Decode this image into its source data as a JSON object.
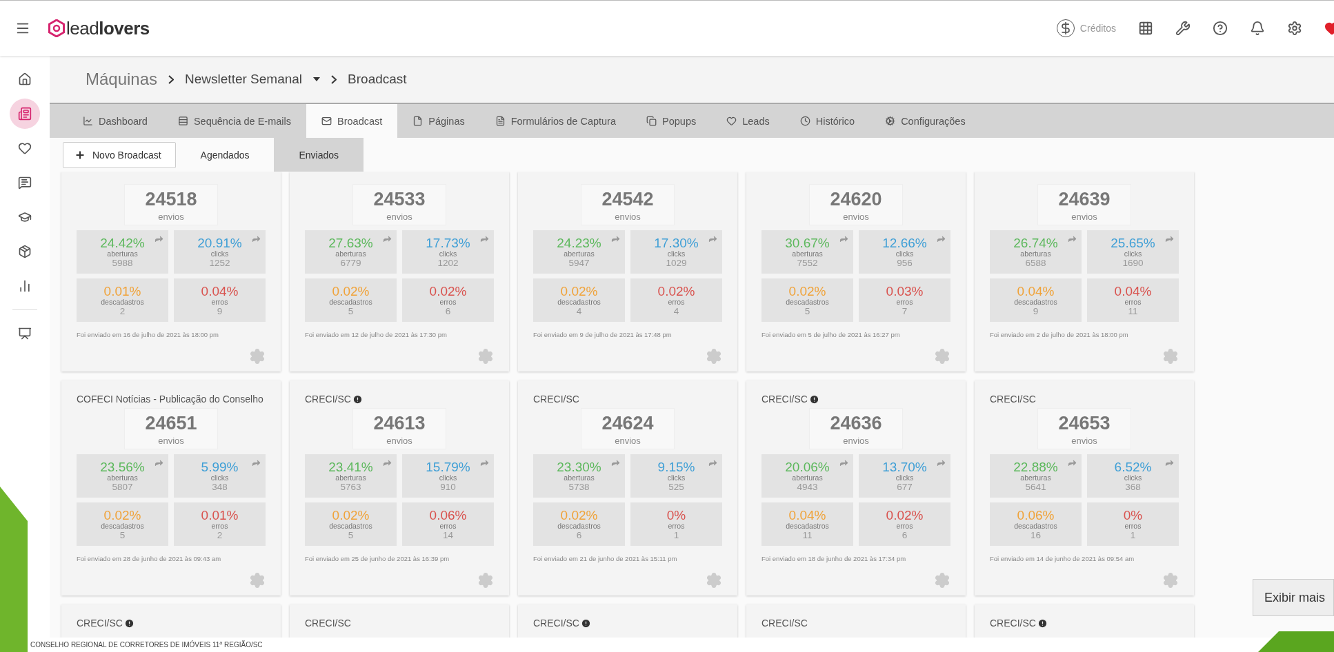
{
  "header": {
    "logo": "lead**lovers**",
    "credits": "Créditos"
  },
  "sidebar": {
    "items": [
      {
        "selected": false
      },
      {
        "selected": true
      },
      {
        "selected": false
      },
      {
        "selected": false
      },
      {
        "selected": false
      },
      {
        "selected": false
      },
      {
        "selected": false
      },
      {
        "selected": false
      }
    ]
  },
  "breadcrumb": {
    "root": "Máquinas",
    "machine": "Newsletter Semanal",
    "current": "Broadcast"
  },
  "tabs": [
    {
      "label": "Dashboard",
      "selected": false
    },
    {
      "label": "Sequência de E-mails",
      "selected": false
    },
    {
      "label": "Broadcast",
      "selected": true
    },
    {
      "label": "Páginas",
      "selected": false
    },
    {
      "label": "Formulários de Captura",
      "selected": false
    },
    {
      "label": "Popups",
      "selected": false
    },
    {
      "label": "Leads",
      "selected": false
    },
    {
      "label": "Histórico",
      "selected": false
    },
    {
      "label": "Configurações",
      "selected": false
    }
  ],
  "subtabs": [
    {
      "kind": "button",
      "label": "Novo Broadcast",
      "selected": false
    },
    {
      "kind": "tab",
      "label": "Agendados",
      "selected": false
    },
    {
      "kind": "tab",
      "label": "Enviados",
      "selected": true
    }
  ],
  "cards": [
    {
      "sends": "24518",
      "sends_label": "envios",
      "date": "Foi enviado em 16 de julho de 2021 às 18:00 pm",
      "stats": [
        {
          "kind": "opens",
          "percent": "24.42%",
          "label": "aberturas",
          "count": "5988"
        },
        {
          "kind": "clicks",
          "percent": "20.91%",
          "label": "clicks",
          "count": "1252"
        },
        {
          "kind": "unsubs",
          "percent": "0.01%",
          "label": "descadastros",
          "count": "2"
        },
        {
          "kind": "errors",
          "percent": "0.04%",
          "label": "erros",
          "count": "9"
        }
      ]
    },
    {
      "sends": "24533",
      "sends_label": "envios",
      "date": "Foi enviado em 12 de julho de 2021 às 17:30 pm",
      "stats": [
        {
          "kind": "opens",
          "percent": "27.63%",
          "label": "aberturas",
          "count": "6779"
        },
        {
          "kind": "clicks",
          "percent": "17.73%",
          "label": "clicks",
          "count": "1202"
        },
        {
          "kind": "unsubs",
          "percent": "0.02%",
          "label": "descadastros",
          "count": "5"
        },
        {
          "kind": "errors",
          "percent": "0.02%",
          "label": "erros",
          "count": "6"
        }
      ]
    },
    {
      "sends": "24542",
      "sends_label": "envios",
      "date": "Foi enviado em 9 de julho de 2021 às 17:48 pm",
      "stats": [
        {
          "kind": "opens",
          "percent": "24.23%",
          "label": "aberturas",
          "count": "5947"
        },
        {
          "kind": "clicks",
          "percent": "17.30%",
          "label": "clicks",
          "count": "1029"
        },
        {
          "kind": "unsubs",
          "percent": "0.02%",
          "label": "descadastros",
          "count": "4"
        },
        {
          "kind": "errors",
          "percent": "0.02%",
          "label": "erros",
          "count": "4"
        }
      ]
    },
    {
      "sends": "24620",
      "sends_label": "envios",
      "date": "Foi enviado em 5 de julho de 2021 às 16:27 pm",
      "stats": [
        {
          "kind": "opens",
          "percent": "30.67%",
          "label": "aberturas",
          "count": "7552"
        },
        {
          "kind": "clicks",
          "percent": "12.66%",
          "label": "clicks",
          "count": "956"
        },
        {
          "kind": "unsubs",
          "percent": "0.02%",
          "label": "descadastros",
          "count": "5"
        },
        {
          "kind": "errors",
          "percent": "0.03%",
          "label": "erros",
          "count": "7"
        }
      ]
    },
    {
      "sends": "24639",
      "sends_label": "envios",
      "date": "Foi enviado em 2 de julho de 2021 às 18:00 pm",
      "stats": [
        {
          "kind": "opens",
          "percent": "26.74%",
          "label": "aberturas",
          "count": "6588"
        },
        {
          "kind": "clicks",
          "percent": "25.65%",
          "label": "clicks",
          "count": "1690"
        },
        {
          "kind": "unsubs",
          "percent": "0.04%",
          "label": "descadastros",
          "count": "9"
        },
        {
          "kind": "errors",
          "percent": "0.04%",
          "label": "erros",
          "count": "11"
        }
      ]
    },
    {
      "title": "COFECI Notícias - Publicação do Conselho",
      "alert": false,
      "sends": "24651",
      "sends_label": "envios",
      "date": "Foi enviado em 28 de junho de 2021 às 09:43 am",
      "stats": [
        {
          "kind": "opens",
          "percent": "23.56%",
          "label": "aberturas",
          "count": "5807"
        },
        {
          "kind": "clicks",
          "percent": "5.99%",
          "label": "clicks",
          "count": "348"
        },
        {
          "kind": "unsubs",
          "percent": "0.02%",
          "label": "descadastros",
          "count": "5"
        },
        {
          "kind": "errors",
          "percent": "0.01%",
          "label": "erros",
          "count": "2"
        }
      ]
    },
    {
      "title": "CRECI/SC",
      "alert": true,
      "sends": "24613",
      "sends_label": "envios",
      "date": "Foi enviado em 25 de junho de 2021 às 16:39 pm",
      "stats": [
        {
          "kind": "opens",
          "percent": "23.41%",
          "label": "aberturas",
          "count": "5763"
        },
        {
          "kind": "clicks",
          "percent": "15.79%",
          "label": "clicks",
          "count": "910"
        },
        {
          "kind": "unsubs",
          "percent": "0.02%",
          "label": "descadastros",
          "count": "5"
        },
        {
          "kind": "errors",
          "percent": "0.06%",
          "label": "erros",
          "count": "14"
        }
      ]
    },
    {
      "title": "CRECI/SC",
      "alert": false,
      "sends": "24624",
      "sends_label": "envios",
      "date": "Foi enviado em 21 de junho de 2021 às 15:11 pm",
      "stats": [
        {
          "kind": "opens",
          "percent": "23.30%",
          "label": "aberturas",
          "count": "5738"
        },
        {
          "kind": "clicks",
          "percent": "9.15%",
          "label": "clicks",
          "count": "525"
        },
        {
          "kind": "unsubs",
          "percent": "0.02%",
          "label": "descadastros",
          "count": "6"
        },
        {
          "kind": "errors",
          "percent": "0%",
          "label": "erros",
          "count": "1"
        }
      ]
    },
    {
      "title": "CRECI/SC",
      "alert": true,
      "sends": "24636",
      "sends_label": "envios",
      "date": "Foi enviado em 18 de junho de 2021 às 17:34 pm",
      "stats": [
        {
          "kind": "opens",
          "percent": "20.06%",
          "label": "aberturas",
          "count": "4943"
        },
        {
          "kind": "clicks",
          "percent": "13.70%",
          "label": "clicks",
          "count": "677"
        },
        {
          "kind": "unsubs",
          "percent": "0.04%",
          "label": "descadastros",
          "count": "11"
        },
        {
          "kind": "errors",
          "percent": "0.02%",
          "label": "erros",
          "count": "6"
        }
      ]
    },
    {
      "title": "CRECI/SC",
      "alert": false,
      "sends": "24653",
      "sends_label": "envios",
      "date": "Foi enviado em 14 de junho de 2021 às 09:54 am",
      "stats": [
        {
          "kind": "opens",
          "percent": "22.88%",
          "label": "aberturas",
          "count": "5641"
        },
        {
          "kind": "clicks",
          "percent": "6.52%",
          "label": "clicks",
          "count": "368"
        },
        {
          "kind": "unsubs",
          "percent": "0.06%",
          "label": "descadastros",
          "count": "16"
        },
        {
          "kind": "errors",
          "percent": "0%",
          "label": "erros",
          "count": "1"
        }
      ]
    },
    {
      "title": "CRECI/SC",
      "alert": true
    },
    {
      "title": "CRECI/SC",
      "alert": false
    },
    {
      "title": "CRECI/SC",
      "alert": true
    },
    {
      "title": "CRECI/SC",
      "alert": false
    },
    {
      "title": "CRECI/SC",
      "alert": true
    }
  ],
  "more_button": "Exibir mais",
  "footer": "CONSELHO REGIONAL DE CORRETORES DE IMÓVEIS 11$^{a}$  REGIÃO/SC"
}
